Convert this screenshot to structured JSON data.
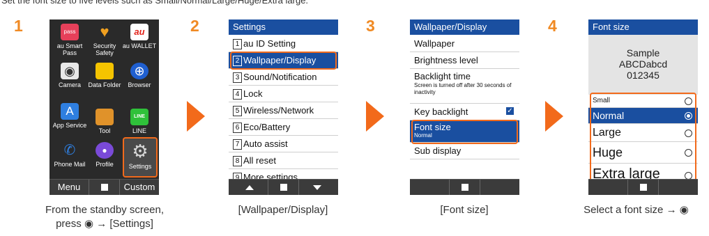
{
  "intro": "Set the font size to five levels such as Small/Normal/Large/Huge/Extra large.",
  "steps": [
    "1",
    "2",
    "3",
    "4"
  ],
  "captions": {
    "c1_line1": "From the standby screen,",
    "c1_line2": "press ◉ → [Settings]",
    "c2": "[Wallpaper/Display]",
    "c3": "[Font size]",
    "c4": "Select a font size → ◉"
  },
  "home_apps": [
    {
      "label": "au Smart Pass",
      "icon": "au-smart-pass-icon",
      "glyph": "pass",
      "color": "#e6405a"
    },
    {
      "label": "Security Safety",
      "icon": "security-heart-icon",
      "glyph": "♥",
      "color": "#f0a020"
    },
    {
      "label": "au WALLET",
      "icon": "au-wallet-icon",
      "glyph": "au",
      "color": "#e2231a"
    },
    {
      "label": "Camera",
      "icon": "camera-icon",
      "glyph": "◉",
      "color": "#555"
    },
    {
      "label": "Data Folder",
      "icon": "folder-icon",
      "glyph": "▬",
      "color": "#f5c400"
    },
    {
      "label": "Browser",
      "icon": "globe-icon",
      "glyph": "⊕",
      "color": "#1f5fd0"
    },
    {
      "label": "App Service",
      "icon": "app-service-icon",
      "glyph": "A",
      "color": "#2f7fe0"
    },
    {
      "label": "Tool",
      "icon": "toolbox-icon",
      "glyph": "▰",
      "color": "#e0922a"
    },
    {
      "label": "LINE",
      "icon": "line-icon",
      "glyph": "LINE",
      "color": "#2fc13a"
    },
    {
      "label": "Phone Mail",
      "icon": "phone-mail-icon",
      "glyph": "✆",
      "color": "#2f7fe0"
    },
    {
      "label": "Profile",
      "icon": "profile-icon",
      "glyph": "●",
      "color": "#7a4ad8"
    },
    {
      "label": "Settings",
      "icon": "gear-icon",
      "glyph": "⚙",
      "color": "#9a9a9a"
    }
  ],
  "softkeys": {
    "menu": "Menu",
    "custom": "Custom"
  },
  "settings": {
    "title": "Settings",
    "items": [
      "au ID Setting",
      "Wallpaper/Display",
      "Sound/Notification",
      "Lock",
      "Wireless/Network",
      "Eco/Battery",
      "Auto assist",
      "All reset",
      "More settings"
    ],
    "nums": [
      "1",
      "2",
      "3",
      "4",
      "5",
      "6",
      "7",
      "8",
      "9"
    ]
  },
  "display": {
    "title": "Wallpaper/Display",
    "wallpaper": "Wallpaper",
    "brightness": "Brightness level",
    "backlight": "Backlight time",
    "backlight_note": "Screen is turned off after 30 seconds of inactivity",
    "key_backlight": "Key backlight",
    "key_backlight_check": "✓",
    "font_size": "Font size",
    "font_size_value": "Normal",
    "sub_display": "Sub display"
  },
  "font": {
    "title": "Font size",
    "sample1": "Sample",
    "sample2": "ABCDabcd",
    "sample3": "012345",
    "options": [
      "Small",
      "Normal",
      "Large",
      "Huge",
      "Extra large"
    ],
    "selected": "Normal"
  }
}
